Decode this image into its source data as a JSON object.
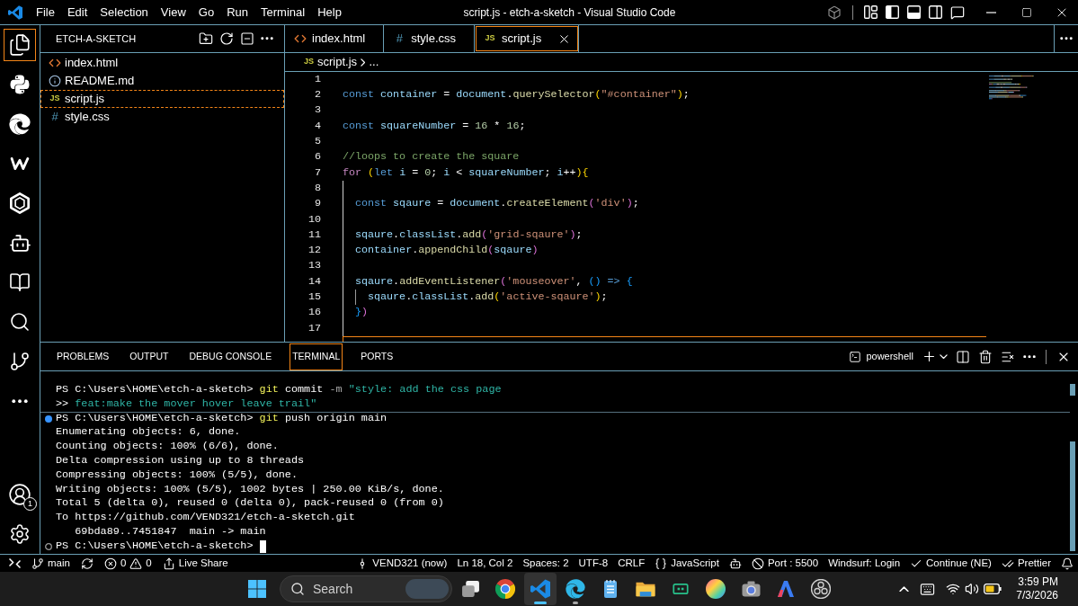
{
  "title_bar": {
    "menu": [
      "File",
      "Edit",
      "Selection",
      "View",
      "Go",
      "Run",
      "Terminal",
      "Help"
    ],
    "title": "script.js - etch-a-sketch - Visual Studio Code",
    "layout_toggles": [
      {
        "on": true
      },
      {
        "on": true
      },
      {
        "on": false
      }
    ]
  },
  "activity_bar": {
    "items": [
      {
        "selected": true
      },
      {
        "selected": false
      },
      {
        "selected": false
      },
      {
        "selected": false
      },
      {
        "selected": false
      },
      {
        "selected": false
      },
      {
        "selected": false
      },
      {
        "selected": false
      },
      {
        "selected": false
      },
      {
        "selected": false
      }
    ],
    "account_badge": "1"
  },
  "sidebar": {
    "title": "ETCH-A-SKETCH",
    "files": [
      {
        "name": "index.html",
        "kind": "html",
        "selected": false
      },
      {
        "name": "README.md",
        "kind": "info",
        "selected": false
      },
      {
        "name": "script.js",
        "kind": "js",
        "icon_label": "JS",
        "selected": true
      },
      {
        "name": "style.css",
        "kind": "css",
        "icon_label": "#",
        "selected": false
      }
    ]
  },
  "editor": {
    "tabs": [
      {
        "label": "index.html",
        "kind": "html",
        "selected": false
      },
      {
        "label": "style.css",
        "kind": "css",
        "icon_label": "#",
        "selected": false
      },
      {
        "label": "script.js",
        "kind": "js",
        "icon_label": "JS",
        "selected": true
      }
    ],
    "breadcrumb": {
      "icon_label": "JS",
      "file": "script.js",
      "rest": "..."
    },
    "lines": [
      {
        "number": "1"
      },
      {
        "number": "2",
        "tokens": [
          {
            "text": "const ",
            "kind": "kw"
          },
          {
            "text": "container",
            "kind": "var"
          },
          {
            "text": " = ",
            "kind": "op"
          },
          {
            "text": "document",
            "kind": "var"
          },
          {
            "text": ".",
            "kind": "op"
          },
          {
            "text": "querySelector",
            "kind": "fn"
          },
          {
            "text": "(",
            "kind": "b1"
          },
          {
            "text": "\"#container\"",
            "kind": "str"
          },
          {
            "text": ")",
            "kind": "b1"
          },
          {
            "text": ";",
            "kind": "op"
          }
        ]
      },
      {
        "number": "3"
      },
      {
        "number": "4",
        "tokens": [
          {
            "text": "const ",
            "kind": "kw"
          },
          {
            "text": "squareNumber",
            "kind": "var"
          },
          {
            "text": " = ",
            "kind": "op"
          },
          {
            "text": "16",
            "kind": "num"
          },
          {
            "text": " * ",
            "kind": "op"
          },
          {
            "text": "16",
            "kind": "num"
          },
          {
            "text": ";",
            "kind": "op"
          }
        ]
      },
      {
        "number": "5"
      },
      {
        "number": "6",
        "tokens": [
          {
            "text": "//loops to create the square",
            "kind": "cmt"
          }
        ]
      },
      {
        "number": "7",
        "tokens": [
          {
            "text": "for ",
            "kind": "ctrl"
          },
          {
            "text": "(",
            "kind": "b1"
          },
          {
            "text": "let ",
            "kind": "kw"
          },
          {
            "text": "i",
            "kind": "var"
          },
          {
            "text": " = ",
            "kind": "op"
          },
          {
            "text": "0",
            "kind": "num"
          },
          {
            "text": "; ",
            "kind": "op"
          },
          {
            "text": "i",
            "kind": "var"
          },
          {
            "text": " < ",
            "kind": "op"
          },
          {
            "text": "squareNumber",
            "kind": "var"
          },
          {
            "text": "; ",
            "kind": "op"
          },
          {
            "text": "i",
            "kind": "var"
          },
          {
            "text": "++",
            "kind": "op"
          },
          {
            "text": ")",
            "kind": "b1"
          },
          {
            "text": "{",
            "kind": "b1"
          }
        ]
      },
      {
        "number": "8"
      },
      {
        "number": "9",
        "tokens": [
          {
            "text": "  const ",
            "kind": "kw"
          },
          {
            "text": "sqaure",
            "kind": "var"
          },
          {
            "text": " = ",
            "kind": "op"
          },
          {
            "text": "document",
            "kind": "var"
          },
          {
            "text": ".",
            "kind": "op"
          },
          {
            "text": "createElement",
            "kind": "fn"
          },
          {
            "text": "(",
            "kind": "b2"
          },
          {
            "text": "'div'",
            "kind": "str"
          },
          {
            "text": ")",
            "kind": "b2"
          },
          {
            "text": ";",
            "kind": "op"
          }
        ]
      },
      {
        "number": "10"
      },
      {
        "number": "11",
        "tokens": [
          {
            "text": "  sqaure",
            "kind": "var"
          },
          {
            "text": ".",
            "kind": "op"
          },
          {
            "text": "classList",
            "kind": "var"
          },
          {
            "text": ".",
            "kind": "op"
          },
          {
            "text": "add",
            "kind": "fn"
          },
          {
            "text": "(",
            "kind": "b2"
          },
          {
            "text": "'grid-sqaure'",
            "kind": "str"
          },
          {
            "text": ")",
            "kind": "b2"
          },
          {
            "text": ";",
            "kind": "op"
          }
        ]
      },
      {
        "number": "12",
        "tokens": [
          {
            "text": "  container",
            "kind": "var"
          },
          {
            "text": ".",
            "kind": "op"
          },
          {
            "text": "appendChild",
            "kind": "fn"
          },
          {
            "text": "(",
            "kind": "b2"
          },
          {
            "text": "sqaure",
            "kind": "var"
          },
          {
            "text": ")",
            "kind": "b2"
          }
        ]
      },
      {
        "number": "13"
      },
      {
        "number": "14",
        "tokens": [
          {
            "text": "  sqaure",
            "kind": "var"
          },
          {
            "text": ".",
            "kind": "op"
          },
          {
            "text": "addEventListener",
            "kind": "fn"
          },
          {
            "text": "(",
            "kind": "b2"
          },
          {
            "text": "'mouseover'",
            "kind": "str"
          },
          {
            "text": ", ",
            "kind": "op"
          },
          {
            "text": "()",
            "kind": "b3"
          },
          {
            "text": " => ",
            "kind": "kw"
          },
          {
            "text": "{",
            "kind": "b3"
          }
        ]
      },
      {
        "number": "15",
        "tokens": [
          {
            "text": "    sqaure",
            "kind": "var"
          },
          {
            "text": ".",
            "kind": "op"
          },
          {
            "text": "classList",
            "kind": "var"
          },
          {
            "text": ".",
            "kind": "op"
          },
          {
            "text": "add",
            "kind": "fn"
          },
          {
            "text": "(",
            "kind": "b1"
          },
          {
            "text": "'active-sqaure'",
            "kind": "str"
          },
          {
            "text": ")",
            "kind": "b1"
          },
          {
            "text": ";",
            "kind": "op"
          }
        ]
      },
      {
        "number": "16",
        "tokens": [
          {
            "text": "  }",
            "kind": "b3"
          },
          {
            "text": ")",
            "kind": "b2"
          }
        ]
      },
      {
        "number": "17"
      }
    ],
    "current_line_highlight": true
  },
  "panel": {
    "tabs": [
      {
        "label": "PROBLEMS",
        "selected": false
      },
      {
        "label": "OUTPUT",
        "selected": false
      },
      {
        "label": "DEBUG CONSOLE",
        "selected": false
      },
      {
        "label": "TERMINAL",
        "selected": true
      },
      {
        "label": "PORTS",
        "selected": false
      }
    ],
    "terminal_profile": "powershell",
    "terminal_lines": [
      {
        "kind": "plain",
        "tokens": [
          {
            "text": "PS C:\\Users\\HOME\\etch-a-sketch> ",
            "kind": "prompt"
          },
          {
            "text": "git",
            "kind": "command"
          },
          {
            "text": " commit",
            "kind": "arg"
          },
          {
            "text": " -m",
            "kind": "flag"
          },
          {
            "text": " \"style: add the css page",
            "kind": "string"
          }
        ]
      },
      {
        "kind": "plain",
        "tokens": [
          {
            "text": ">> ",
            "kind": "prompt"
          },
          {
            "text": "feat:make the mover hover leave trail\"",
            "kind": "string"
          }
        ]
      },
      {
        "kind": "success",
        "tokens": [
          {
            "text": "PS C:\\Users\\HOME\\etch-a-sketch> ",
            "kind": "prompt"
          },
          {
            "text": "git",
            "kind": "command"
          },
          {
            "text": " push origin main",
            "kind": "arg"
          }
        ]
      },
      {
        "kind": "plain",
        "tokens": [
          {
            "text": "Enumerating objects: 6, done.",
            "kind": "output"
          }
        ]
      },
      {
        "kind": "plain",
        "tokens": [
          {
            "text": "Counting objects: 100% (6/6), done.",
            "kind": "output"
          }
        ]
      },
      {
        "kind": "plain",
        "tokens": [
          {
            "text": "Delta compression using up to 8 threads",
            "kind": "output"
          }
        ]
      },
      {
        "kind": "plain",
        "tokens": [
          {
            "text": "Compressing objects: 100% (5/5), done.",
            "kind": "output"
          }
        ]
      },
      {
        "kind": "plain",
        "tokens": [
          {
            "text": "Writing objects: 100% (5/5), 1002 bytes | 250.00 KiB/s, done.",
            "kind": "output"
          }
        ]
      },
      {
        "kind": "plain",
        "tokens": [
          {
            "text": "Total 5 (delta 0), reused 0 (delta 0), pack-reused 0 (from 0)",
            "kind": "output"
          }
        ]
      },
      {
        "kind": "plain",
        "tokens": [
          {
            "text": "To https://github.com/VEND321/etch-a-sketch.git",
            "kind": "output"
          }
        ]
      },
      {
        "kind": "plain",
        "tokens": [
          {
            "text": "   69bda89..7451847  main -> main",
            "kind": "output"
          }
        ]
      },
      {
        "kind": "pending",
        "cursor": true,
        "tokens": [
          {
            "text": "PS C:\\Users\\HOME\\etch-a-sketch> ",
            "kind": "prompt"
          }
        ]
      }
    ]
  },
  "status_bar": {
    "left": [
      {
        "kind": "remote"
      },
      {
        "kind": "branch",
        "text": "main"
      },
      {
        "kind": "sync"
      },
      {
        "kind": "problems",
        "errors": "0",
        "warnings": "0"
      },
      {
        "kind": "liveshare",
        "text": "Live Share"
      }
    ],
    "right": [
      {
        "kind": "commit",
        "text": "VEND321 (now)"
      },
      {
        "kind": "text",
        "text": "Ln 18, Col 2"
      },
      {
        "kind": "text",
        "text": "Spaces: 2"
      },
      {
        "kind": "text",
        "text": "UTF-8"
      },
      {
        "kind": "text",
        "text": "CRLF"
      },
      {
        "kind": "language",
        "text": "JavaScript"
      },
      {
        "kind": "assistant"
      },
      {
        "kind": "port",
        "text": "Port : 5500"
      },
      {
        "kind": "text",
        "text": "Windsurf: Login"
      },
      {
        "kind": "check",
        "text": "Continue (NE)"
      },
      {
        "kind": "double_check",
        "text": "Prettier"
      },
      {
        "kind": "bell"
      }
    ]
  },
  "taskbar": {
    "search": {
      "placeholder": "Search"
    },
    "apps": [
      {
        "selected": false,
        "running": false
      },
      {
        "selected": false,
        "running": false
      },
      {
        "selected": true,
        "running": true
      },
      {
        "selected": false,
        "running": true
      },
      {
        "selected": false,
        "running": false
      },
      {
        "selected": false,
        "running": false
      },
      {
        "selected": false,
        "running": false
      },
      {
        "selected": false,
        "running": false
      },
      {
        "selected": false,
        "running": false
      },
      {
        "selected": false,
        "running": false
      },
      {
        "selected": false,
        "running": false
      }
    ],
    "clock": {
      "time": "3:59 PM",
      "date": "7/3/2026"
    }
  }
}
